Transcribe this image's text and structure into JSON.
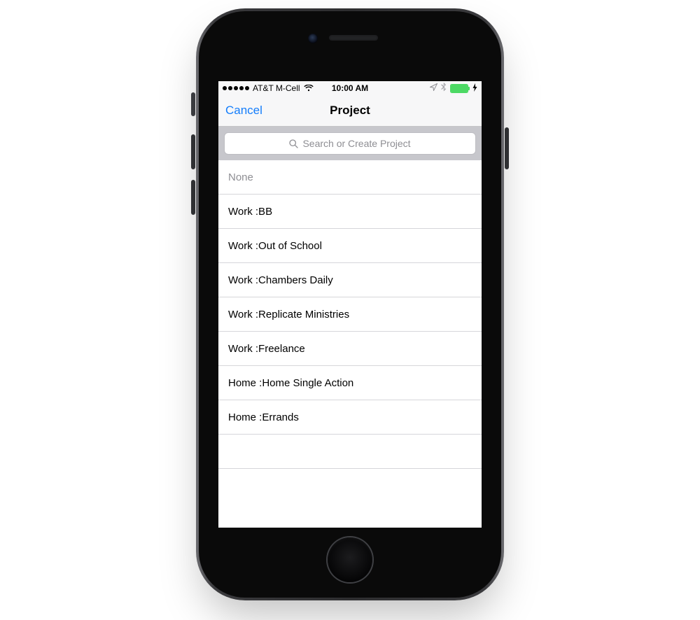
{
  "status_bar": {
    "carrier": "AT&T M-Cell",
    "time": "10:00 AM",
    "location_icon": "location-arrow",
    "bluetooth_icon": "bluetooth",
    "battery_charging_glyph": "↯"
  },
  "nav": {
    "cancel_label": "Cancel",
    "title": "Project"
  },
  "search": {
    "placeholder": "Search or Create Project"
  },
  "list": {
    "none_label": "None",
    "items": [
      {
        "label": "Work :BB"
      },
      {
        "label": "Work :Out of School"
      },
      {
        "label": "Work :Chambers Daily"
      },
      {
        "label": "Work :Replicate Ministries"
      },
      {
        "label": "Work :Freelance"
      },
      {
        "label": "Home :Home Single Action"
      },
      {
        "label": "Home :Errands"
      }
    ]
  }
}
